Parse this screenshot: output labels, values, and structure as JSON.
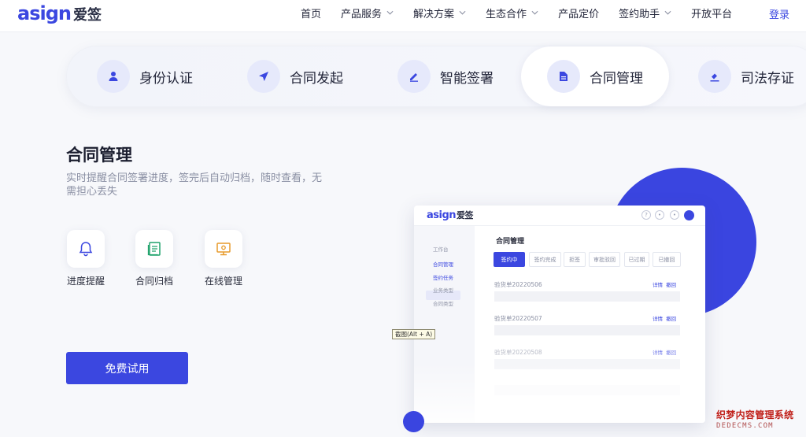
{
  "brand": {
    "logo_main": "asign",
    "logo_cn": "爱签"
  },
  "nav": {
    "items": [
      {
        "label": "首页",
        "has_dropdown": false
      },
      {
        "label": "产品服务",
        "has_dropdown": true
      },
      {
        "label": "解决方案",
        "has_dropdown": true
      },
      {
        "label": "生态合作",
        "has_dropdown": true
      },
      {
        "label": "产品定价",
        "has_dropdown": false
      },
      {
        "label": "签约助手",
        "has_dropdown": true
      },
      {
        "label": "开放平台",
        "has_dropdown": false
      }
    ],
    "login_label": "登录"
  },
  "tabs": [
    {
      "label": "身份认证",
      "icon": "user-icon",
      "active": false
    },
    {
      "label": "合同发起",
      "icon": "send-icon",
      "active": false
    },
    {
      "label": "智能签署",
      "icon": "pen-icon",
      "active": false
    },
    {
      "label": "合同管理",
      "icon": "document-icon",
      "active": true
    },
    {
      "label": "司法存证",
      "icon": "gavel-icon",
      "active": false
    }
  ],
  "main": {
    "title": "合同管理",
    "description": "实时提醒合同签署进度，签完后自动归档，随时查看，无需担心丢失",
    "features": [
      {
        "label": "进度提醒",
        "icon": "bell-icon"
      },
      {
        "label": "合同归档",
        "icon": "archive-book-icon"
      },
      {
        "label": "在线管理",
        "icon": "monitor-icon"
      }
    ],
    "cta_label": "免费试用"
  },
  "mockup": {
    "logo_main": "asign",
    "logo_cn": "爱签",
    "sidebar": [
      {
        "label": "工作台",
        "active": false
      },
      {
        "label": "合同管理",
        "active": true
      },
      {
        "label": "签约任务",
        "active": true
      },
      {
        "label": "业务类型",
        "active": false
      },
      {
        "label": "合同类型",
        "active": false
      }
    ],
    "title": "合同管理",
    "tabs": [
      "签约中",
      "签约完成",
      "拒签",
      "审批驳回",
      "已过期",
      "已撤回"
    ],
    "rows": [
      {
        "name": "验货单20220506",
        "action_detail": "详情",
        "action_revoke": "撤回"
      },
      {
        "name": "验货单20220507",
        "action_detail": "详情",
        "action_revoke": "撤回"
      },
      {
        "name": "验货单20220508",
        "action_detail": "详情",
        "action_revoke": "撤回"
      }
    ]
  },
  "screenshot_tip": "截图(Alt + A)",
  "watermark": {
    "line1": "织梦内容管理系统",
    "line2": "DEDECMS.COM"
  },
  "colors": {
    "brand_blue": "#3b47e0",
    "icon_bg": "#e6e9fb",
    "text_muted": "#8a8fa3",
    "feature_bell": "#3b47e0",
    "feature_book": "#1fa26b",
    "feature_monitor": "#e79a2a"
  }
}
